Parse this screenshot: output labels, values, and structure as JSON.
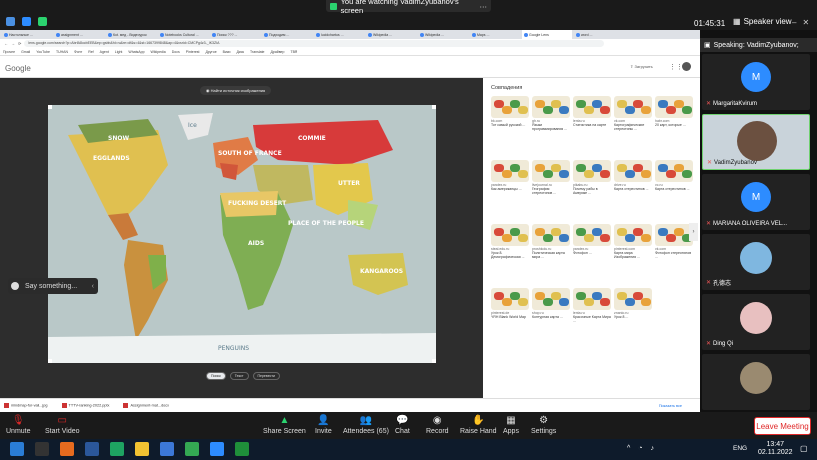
{
  "zoom": {
    "share_banner": "You are watching VadimZyubanov's screen",
    "timer": "01:45:31",
    "view_button": "Speaker view",
    "speaking_label": "Speaking: VadimZyubanov;",
    "leave_label": "Leave Meeting"
  },
  "browser": {
    "tabs": [
      "Настольные ...",
      "assignment ...",
      "Коt. мед - Видеоурок",
      "Notebooks Cultural ...",
      "Поиск ??? ...",
      "Подходим ...",
      "lucidchartus ...",
      "Wikipedia ...",
      "Wikipedia ...",
      "Maps ...",
      "Google Lens",
      "word ..."
    ],
    "url": "lens.google.com/search?p=AbrfA8ocbEEB&ep=gsbb&hl=ru&re=df&s=4&st=1667399848&ap=4&vsrid=CMCPg4z3-_IK3ZIA",
    "bookmarks": [
      "Прочее",
      "Gmail",
      "YouTube",
      "TUHAN",
      "Фонт",
      "Ref",
      "Agent",
      "Light",
      "WhatsApp",
      "Wikipedia",
      "Docs",
      "Pinterest",
      "Другое",
      "Вики",
      "Диск",
      "Translate",
      "Драйвер",
      "ТВЯ"
    ],
    "google_logo": "Google",
    "upload_label": "Загрузить",
    "find_source": "Найти источник изображения",
    "pills": [
      "Поиск",
      "Текст",
      "Перевести"
    ],
    "map_labels": [
      "EGGLANDS",
      "SOUTH OF FRANCE",
      "FUCKING DESERT",
      "AIDS",
      "UTTER",
      "COMMIE",
      "SNOW",
      "KANGAROOS",
      "PLACE OF THE PEOPLE",
      "PENGUINS",
      "Ice"
    ],
    "results_title": "Совпадения",
    "results": [
      {
        "src": "bk.com",
        "title": "Тот самый русский ..."
      },
      {
        "src": "gh.ru",
        "title": "Языки программирования ..."
      },
      {
        "src": "lenta.ru",
        "title": "Статистика на карте"
      },
      {
        "src": "vk.com",
        "title": "Картографические стереотипы ..."
      },
      {
        "src": "habr.com",
        "title": "20 карт, которые ..."
      },
      {
        "src": "yandex.ru",
        "title": "Как американцы ..."
      },
      {
        "src": "livejournal.ru",
        "title": "География стереотипов ..."
      },
      {
        "src": "pikabu.ru",
        "title": "Почему рабы в Америке ..."
      },
      {
        "src": "drive.ru",
        "title": "Карта стереотипов ..."
      },
      {
        "src": "vc.ru",
        "title": "Карта стереотипов ..."
      },
      {
        "src": "steal.edu.ru",
        "title": "Урок 8. Демографическая ..."
      },
      {
        "src": "proshkolu.ru",
        "title": "Политическая карта мира ..."
      },
      {
        "src": "yandex.ru",
        "title": "Фотофон ..."
      },
      {
        "src": "pinterest.com",
        "title": "Карта мира Изображения ..."
      },
      {
        "src": "vk.com",
        "title": "Фотофон стереотипов ..."
      },
      {
        "src": "pinterest.de",
        "title": "YRH Blank World Map"
      },
      {
        "src": "shop.ru",
        "title": "Контурная карта ..."
      },
      {
        "src": "lenta.ru",
        "title": "Красочные Карта Мира ..."
      },
      {
        "src": "znanio.ru",
        "title": "Урок 8 ..."
      }
    ],
    "results_footer": "Что думаете о ваших безопасность?",
    "results_buttons": [
      "Да",
      "Нет"
    ],
    "downloads": [
      "mindmap-for-vali...jpg",
      "TTTV-ranking-2022.pptx",
      "Assignment-mat...docx"
    ],
    "show_all": "Показать все"
  },
  "participants": [
    {
      "name": "MargaritaKvirum",
      "initial": "M",
      "type": "avatar"
    },
    {
      "name": "VadimZyubanov",
      "type": "video"
    },
    {
      "name": "MARIANA OLIVEIRA VEL...",
      "initial": "M",
      "type": "avatar"
    },
    {
      "name": "孔德志",
      "type": "photo"
    },
    {
      "name": "Ding Qi",
      "type": "photo"
    },
    {
      "name": "",
      "type": "photo"
    }
  ],
  "side_chat": "Say something...",
  "toolbar": {
    "unmute": "Unmute",
    "start_video": "Start Video",
    "share_screen": "Share Screen",
    "invite": "Invite",
    "attendees": "Attendees (65)",
    "chat": "Chat",
    "record": "Record",
    "raise_hand": "Raise Hand",
    "apps": "Apps",
    "settings": "Settings"
  },
  "taskbar": {
    "lang": "ENG",
    "time": "13:47",
    "date": "02.11.2022"
  }
}
